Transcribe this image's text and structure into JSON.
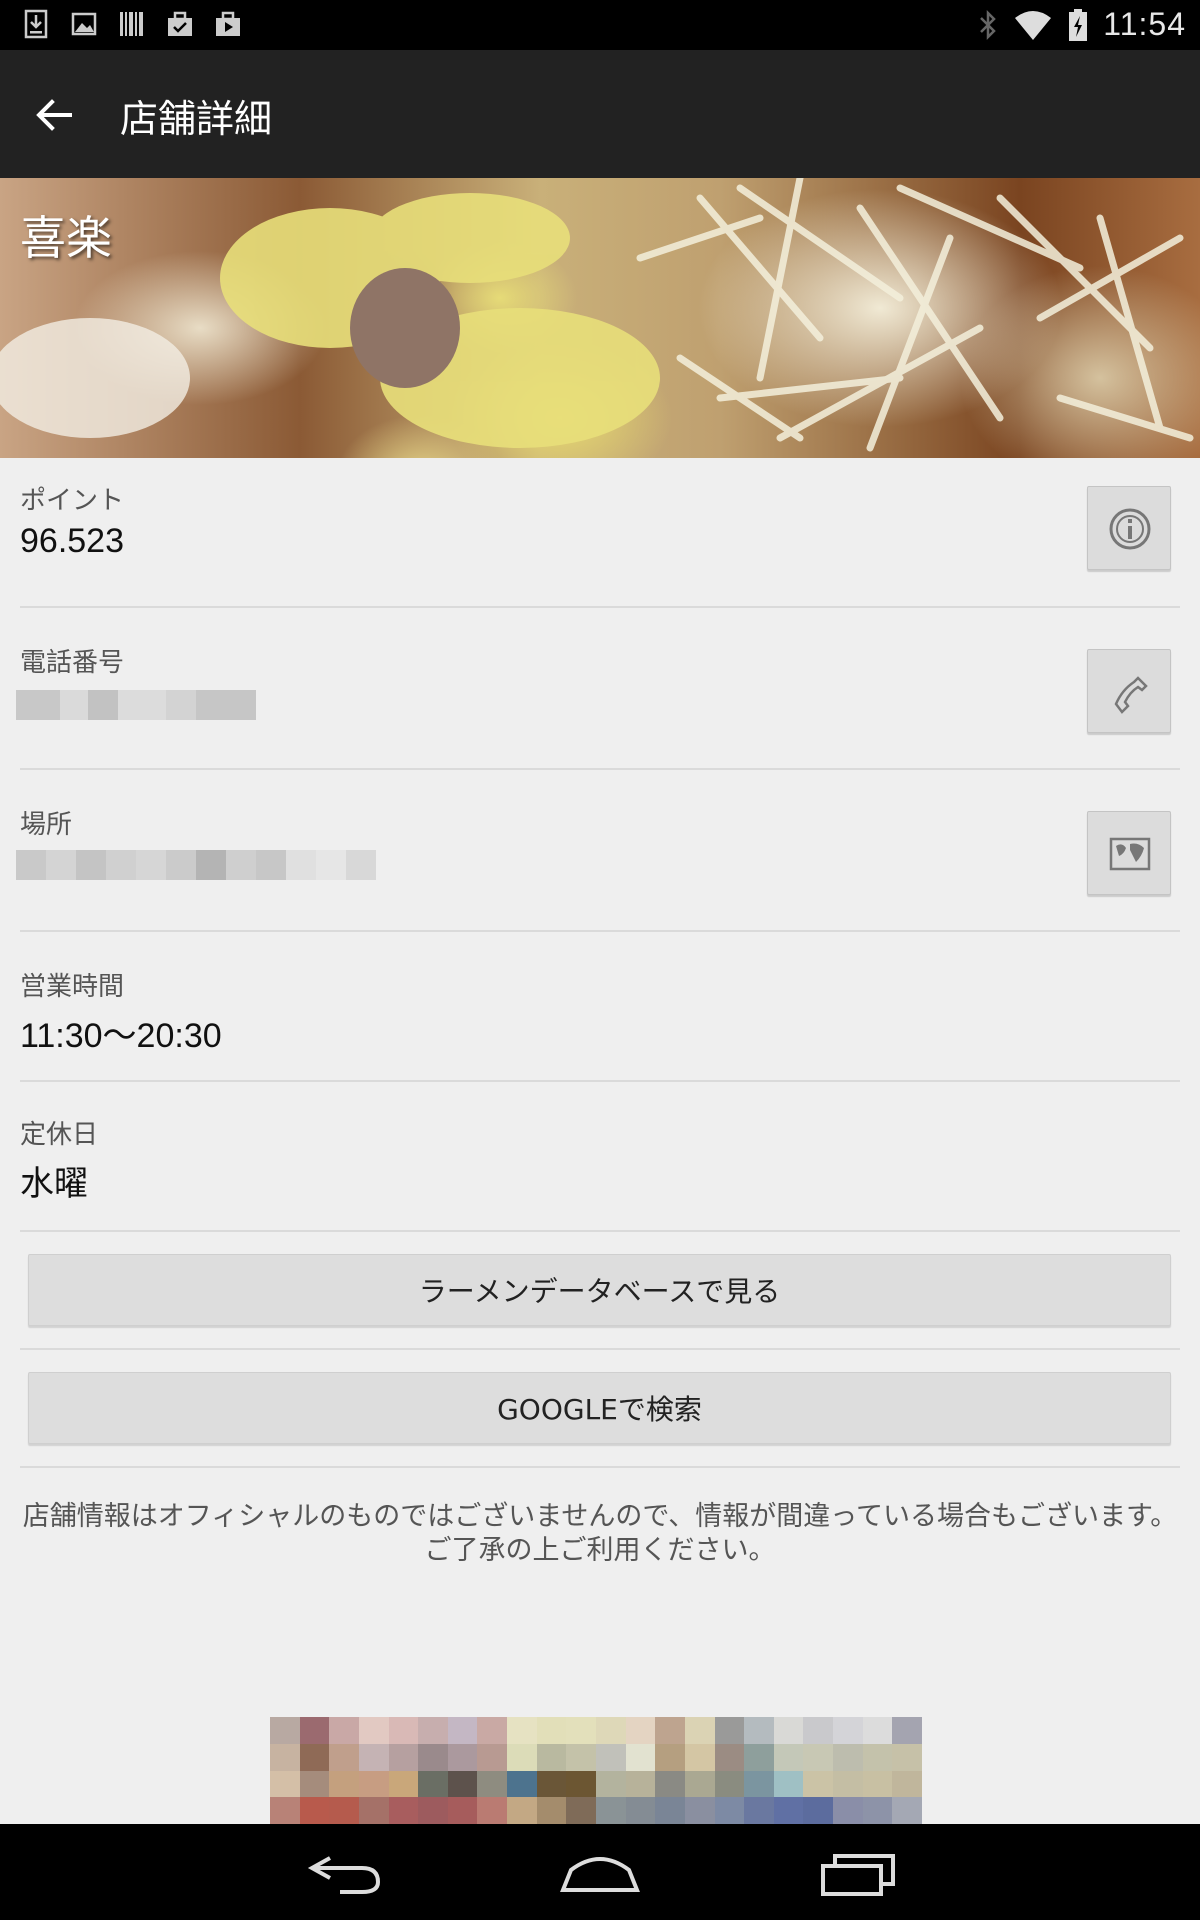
{
  "status_bar": {
    "time": "11:54",
    "left_icons": [
      "download-icon",
      "image-icon",
      "barcode-icon",
      "briefcase-check-icon",
      "briefcase-play-icon"
    ],
    "right_icons": [
      "bluetooth-icon",
      "wifi-icon",
      "battery-charging-icon"
    ]
  },
  "action_bar": {
    "title": "店舗詳細",
    "back_icon": "arrow-left-icon"
  },
  "hero": {
    "store_name": "喜楽"
  },
  "info": {
    "points": {
      "label": "ポイント",
      "value": "96.523",
      "button_icon": "info-icon"
    },
    "phone": {
      "label": "電話番号",
      "button_icon": "phone-icon"
    },
    "location": {
      "label": "場所",
      "button_icon": "map-icon"
    },
    "hours": {
      "label": "営業時間",
      "value": "11:30〜20:30"
    },
    "closed": {
      "label": "定休日",
      "value": "水曜"
    }
  },
  "buttons": {
    "ramen_db": "ラーメンデータベースで見る",
    "google": "GOOGLEで検索"
  },
  "notice": "店舗情報はオフィシャルのものではございませんので、情報が間違っている場合もございます。ご了承の上ご利用ください。",
  "nav_bar": {
    "icons": [
      "back-icon",
      "home-icon",
      "recent-apps-icon"
    ]
  },
  "colors": {
    "status_bar": "#000000",
    "action_bar": "#222222",
    "background": "#efefef",
    "button": "#dddddd"
  }
}
